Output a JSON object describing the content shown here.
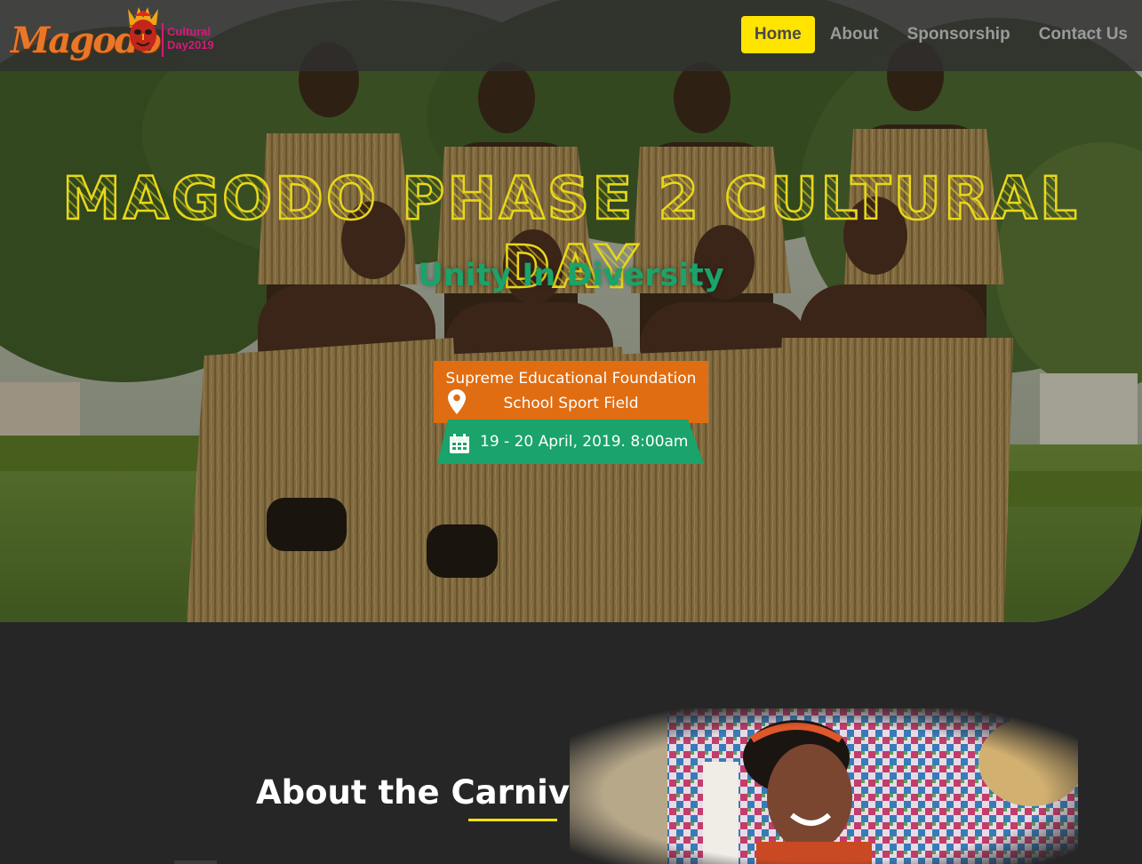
{
  "logo": {
    "wordmark": "Magodo",
    "sub_line1": "Cultural",
    "sub_line2": "Day2019",
    "icon": "mask-icon"
  },
  "nav": {
    "items": [
      {
        "label": "Home",
        "active": true
      },
      {
        "label": "About",
        "active": false
      },
      {
        "label": "Sponsorship",
        "active": false
      },
      {
        "label": "Contact Us",
        "active": false
      }
    ]
  },
  "hero": {
    "title": "MAGODO PHASE 2 CULTURAL DAY",
    "subtitle": "Unity In Diversity",
    "venue_line1": "Supreme Educational Foundation",
    "venue_line2": "School Sport Field",
    "venue_icon": "location-pin-icon",
    "date_text": "19 - 20 April, 2019. 8:00am",
    "date_icon": "calendar-icon"
  },
  "about": {
    "title": "About the Carnival"
  },
  "colors": {
    "accent_yellow": "#ffe400",
    "title_yellow": "#e8d81a",
    "green": "#1aa36a",
    "orange": "#e06d12",
    "background": "#262626"
  }
}
